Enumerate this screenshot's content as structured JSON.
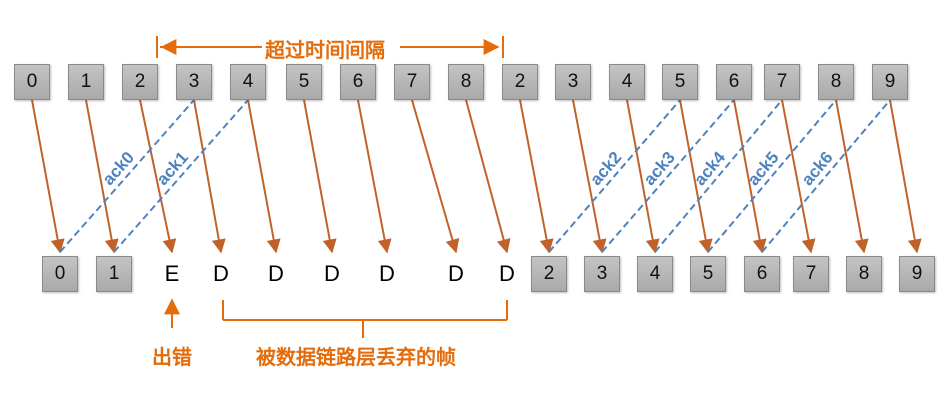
{
  "top_row": [
    "0",
    "1",
    "2",
    "3",
    "4",
    "5",
    "6",
    "7",
    "8",
    "2",
    "3",
    "4",
    "5",
    "6",
    "7",
    "8",
    "9"
  ],
  "bottom_row": [
    {
      "text": "0",
      "kind": "box"
    },
    {
      "text": "1",
      "kind": "box"
    },
    {
      "text": "E",
      "kind": "mark"
    },
    {
      "text": "D",
      "kind": "mark"
    },
    {
      "text": "D",
      "kind": "mark"
    },
    {
      "text": "D",
      "kind": "mark"
    },
    {
      "text": "D",
      "kind": "mark"
    },
    {
      "text": "D",
      "kind": "mark"
    },
    {
      "text": "D",
      "kind": "mark"
    },
    {
      "text": "2",
      "kind": "box"
    },
    {
      "text": "3",
      "kind": "box"
    },
    {
      "text": "4",
      "kind": "box"
    },
    {
      "text": "5",
      "kind": "box"
    },
    {
      "text": "6",
      "kind": "box"
    },
    {
      "text": "7",
      "kind": "box"
    },
    {
      "text": "8",
      "kind": "box"
    },
    {
      "text": "9",
      "kind": "box"
    }
  ],
  "acks": [
    "ack0",
    "ack1",
    "ack2",
    "ack3",
    "ack4",
    "ack5",
    "ack6"
  ],
  "labels": {
    "timeout": "超过时间间隔",
    "error": "出错",
    "discarded": "被数据链路层丢弃的帧"
  },
  "colors": {
    "frame_arrow": "#c0622a",
    "ack_line": "#4f81bd",
    "annotation": "#e46c0a"
  }
}
